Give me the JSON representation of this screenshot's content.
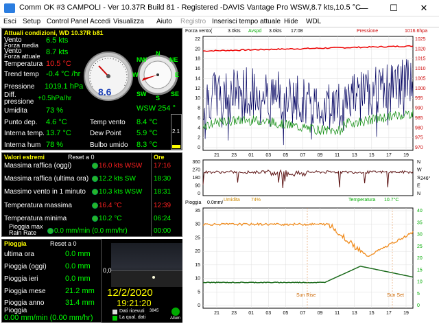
{
  "window": {
    "title": "Comm OK  #3 CAMPOLI - Ver 10.37R Build 81 - Registered  -DAVIS Vantage Pro WSW,8.7 kts,10.5 °C",
    "min": "—",
    "max": "☐",
    "close": "✕"
  },
  "menu": [
    "Esci",
    "Setup",
    "Control Panel",
    "Accedi",
    "Visualizza",
    "Aiuto",
    "Registro",
    "Inserisci tempo attuale",
    "Hide",
    "WDL"
  ],
  "current": {
    "header": "Attuali condizioni, WD 10.37R b81",
    "rows": [
      {
        "label": "Vento",
        "value": "6.5 kts"
      },
      {
        "label": "Forza media",
        "value": ""
      },
      {
        "label": "Vento",
        "value": "8.7 kts"
      },
      {
        "label": "Forza attuale",
        "value": ""
      },
      {
        "label": "Temperatura",
        "value": "10.5 °C"
      },
      {
        "label": "Trend temp",
        "value": "-0.4 °C /hr"
      },
      {
        "label": "Pressione",
        "value": "1019.1 hPa"
      },
      {
        "label": "Diff. pressione",
        "value": "+0.5hPa/hr"
      },
      {
        "label": "Umidita",
        "value": "73 %"
      },
      {
        "label": "Punto dep.",
        "value": "4.6 °C"
      },
      {
        "label": "Interna temp.",
        "value": "13.7 °C"
      },
      {
        "label": "Interna hum",
        "value": "78 %"
      }
    ],
    "gauge_value": "8.6",
    "compass": {
      "n": "N",
      "ne": "NE",
      "nw": "NW",
      "e": "E",
      "w": "W",
      "sw": "SW",
      "s": "S",
      "se": "SE"
    },
    "wind_dir": "WSW 254 °",
    "temp_vento_label": "Temp vento",
    "temp_vento": "8.4 °C",
    "dew_point_label": "Dew Point",
    "dew_point": "5.9 °C",
    "bulbo_label": "Bulbo umido",
    "bulbo": "8.3 °C",
    "side_val": "2.1"
  },
  "extremes": {
    "header": "Valori estremi",
    "reset": "Reset a 0",
    "ore": "Ore",
    "rows": [
      {
        "label": "Massima raffica (oggi)",
        "value": "16.0 kts WSW",
        "time": "17:16",
        "color": "#ff2020"
      },
      {
        "label": "Massima raffica (ultima ora)",
        "value": "12.2 kts  SW",
        "time": "18:30",
        "color": "#00ff00"
      },
      {
        "label": "Massimo vento in 1 minuto",
        "value": "10.3 kts WSW",
        "time": "18:31",
        "color": "#00ff00"
      },
      {
        "label": "Temperatura massima",
        "value": "16.4 °C",
        "time": "12:39",
        "color": "#ff2020"
      },
      {
        "label": "Temperatura minima",
        "value": "10.2 °C",
        "time": "06:24",
        "color": "#00ff00"
      },
      {
        "label": "Pioggia max Rain Rate",
        "value": "0.0 mm/min (0.0 mm/hr)",
        "time": "00:00",
        "color": "#00ff00"
      }
    ]
  },
  "rain": {
    "header": "Pioggia",
    "reset": "Reset a 0",
    "rows": [
      {
        "label": "ultima ora",
        "value": "0.0 mm"
      },
      {
        "label": "Pioggia (oggi)",
        "value": "0.0 mm"
      },
      {
        "label": "Pioggia ieri",
        "value": "0.0 mm"
      },
      {
        "label": "Pioggia mese",
        "value": "21.2 mm"
      },
      {
        "label": "Pioggia anno",
        "value": "31.4 mm"
      },
      {
        "label": "Pioggia",
        "value": "0.00 mm/min (0.00 mm/hr)"
      }
    ]
  },
  "cam": {
    "date": "12/2/2020",
    "time": "19:21:20",
    "scale": "0,0",
    "dati_ricevuti": "Dati ricevuti",
    "la_qual": "La qual. dati",
    "count": "3845",
    "allum": "Allum"
  },
  "chart_top": {
    "legend": {
      "forza": "Forza vento(",
      "forza_v": "3.0kts",
      "avspd": "Avspd",
      "avspd_v": "3.0kts",
      "time": "17:08",
      "press": "Pressione",
      "press_v": "1016.6hpa"
    },
    "y_left": [
      "22",
      "20",
      "18",
      "16",
      "14",
      "12",
      "10",
      "8",
      "6",
      "4",
      "2",
      "0"
    ],
    "y_right": [
      "1025",
      "1020",
      "1015",
      "1010",
      "1005",
      "1000",
      "995",
      "990",
      "985",
      "980",
      "975",
      "970"
    ],
    "x": [
      "21",
      "23",
      "01",
      "03",
      "05",
      "07",
      "09",
      "11",
      "13",
      "15",
      "17",
      "19"
    ]
  },
  "chart_dir": {
    "y": [
      "360",
      "270",
      "180",
      "90",
      "0"
    ],
    "right": [
      "N",
      "W",
      "S",
      "E",
      "N"
    ],
    "deg": "246°",
    "umid": "Umidita",
    "umid_v": "74%",
    "temp": "Temperatura",
    "temp_v": "10.7°C"
  },
  "chart_bot": {
    "pioggia": "Pioggia",
    "pioggia_v": "0.0mm/",
    "y_left": [
      "35",
      "30",
      "25",
      "20",
      "15",
      "10",
      "5",
      "0"
    ],
    "y_right": [
      "40",
      "35",
      "30",
      "25",
      "20",
      "15",
      "10",
      "5",
      "0"
    ],
    "sunrise": "Sun Rise",
    "sunset": "Sun Set",
    "x": [
      "21",
      "23",
      "01",
      "03",
      "05",
      "07",
      "09",
      "11",
      "13",
      "15",
      "17",
      "19"
    ]
  }
}
